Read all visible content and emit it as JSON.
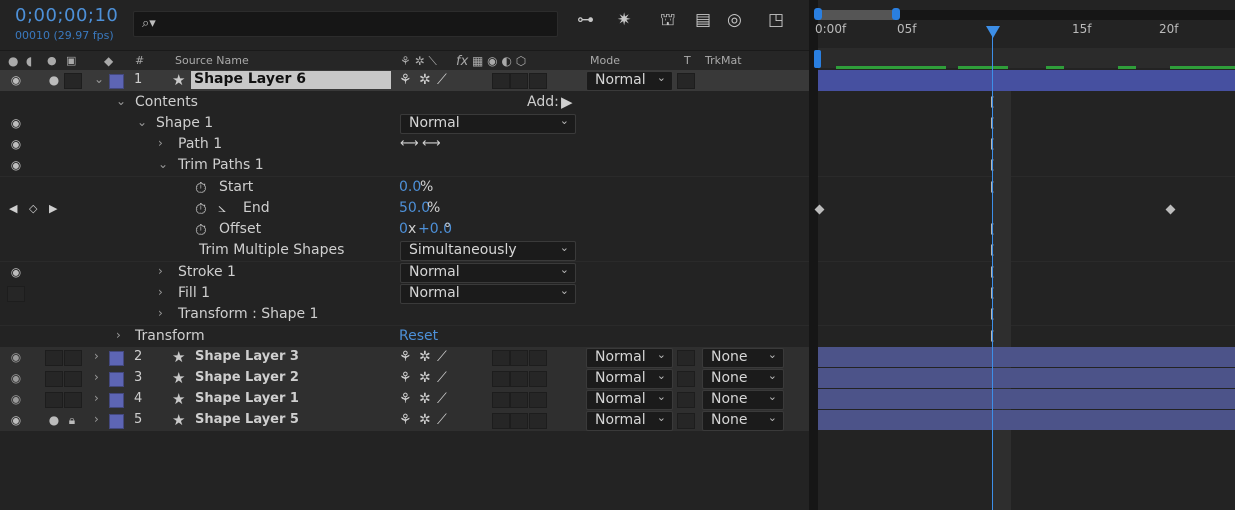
{
  "header": {
    "timecode": "0;00;00;10",
    "frame_info": "00010 (29.97 fps)",
    "search_placeholder": "",
    "search_icon": "magnifier-icon"
  },
  "columns": {
    "hash": "#",
    "source_name": "Source Name",
    "mode": "Mode",
    "t": "T",
    "trkmat": "TrkMat",
    "fx": "fx"
  },
  "layer_top": {
    "index": "1",
    "name": "Shape Layer 6",
    "mode": "Normal"
  },
  "props": {
    "contents": "Contents",
    "add": "Add:",
    "shape1": "Shape 1",
    "shape1_mode": "Normal",
    "path1": "Path 1",
    "trim_paths": "Trim Paths 1",
    "start": "Start",
    "start_val": "0.0",
    "start_unit": "%",
    "end": "End",
    "end_val": "50.0",
    "end_unit": "%",
    "offset": "Offset",
    "offset_val1": "0",
    "offset_x": "x",
    "offset_val2": "+0.0",
    "offset_unit": "°",
    "trim_multiple": "Trim Multiple Shapes",
    "trim_multiple_val": "Simultaneously",
    "stroke1": "Stroke 1",
    "stroke1_mode": "Normal",
    "fill1": "Fill 1",
    "fill1_mode": "Normal",
    "transform_shape": "Transform : Shape 1",
    "transform": "Transform",
    "reset": "Reset"
  },
  "layers": [
    {
      "index": "2",
      "name": "Shape Layer 3",
      "mode": "Normal",
      "trkmat": "None"
    },
    {
      "index": "3",
      "name": "Shape Layer 2",
      "mode": "Normal",
      "trkmat": "None"
    },
    {
      "index": "4",
      "name": "Shape Layer 1",
      "mode": "Normal",
      "trkmat": "None"
    },
    {
      "index": "5",
      "name": "Shape Layer 5",
      "mode": "Normal",
      "trkmat": "None"
    }
  ],
  "timeline": {
    "ticks": [
      "0:00f",
      "05f",
      "15f",
      "20f"
    ]
  },
  "colors": {
    "accent": "#4d90d8",
    "layer_label": "#5d65b4",
    "layer_bar": "#4c5389",
    "work_area_green": "#2f9e3a"
  }
}
